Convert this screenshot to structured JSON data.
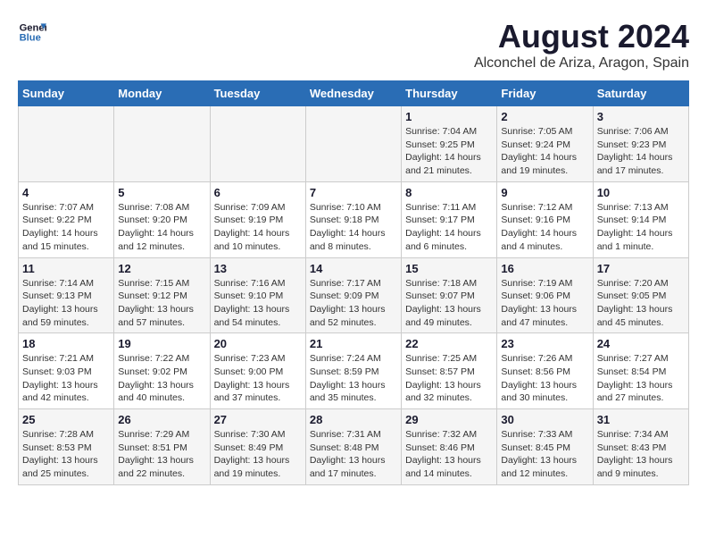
{
  "header": {
    "logo_line1": "General",
    "logo_line2": "Blue",
    "title": "August 2024",
    "subtitle": "Alconchel de Ariza, Aragon, Spain"
  },
  "weekdays": [
    "Sunday",
    "Monday",
    "Tuesday",
    "Wednesday",
    "Thursday",
    "Friday",
    "Saturday"
  ],
  "weeks": [
    [
      {
        "day": "",
        "info": ""
      },
      {
        "day": "",
        "info": ""
      },
      {
        "day": "",
        "info": ""
      },
      {
        "day": "",
        "info": ""
      },
      {
        "day": "1",
        "info": "Sunrise: 7:04 AM\nSunset: 9:25 PM\nDaylight: 14 hours\nand 21 minutes."
      },
      {
        "day": "2",
        "info": "Sunrise: 7:05 AM\nSunset: 9:24 PM\nDaylight: 14 hours\nand 19 minutes."
      },
      {
        "day": "3",
        "info": "Sunrise: 7:06 AM\nSunset: 9:23 PM\nDaylight: 14 hours\nand 17 minutes."
      }
    ],
    [
      {
        "day": "4",
        "info": "Sunrise: 7:07 AM\nSunset: 9:22 PM\nDaylight: 14 hours\nand 15 minutes."
      },
      {
        "day": "5",
        "info": "Sunrise: 7:08 AM\nSunset: 9:20 PM\nDaylight: 14 hours\nand 12 minutes."
      },
      {
        "day": "6",
        "info": "Sunrise: 7:09 AM\nSunset: 9:19 PM\nDaylight: 14 hours\nand 10 minutes."
      },
      {
        "day": "7",
        "info": "Sunrise: 7:10 AM\nSunset: 9:18 PM\nDaylight: 14 hours\nand 8 minutes."
      },
      {
        "day": "8",
        "info": "Sunrise: 7:11 AM\nSunset: 9:17 PM\nDaylight: 14 hours\nand 6 minutes."
      },
      {
        "day": "9",
        "info": "Sunrise: 7:12 AM\nSunset: 9:16 PM\nDaylight: 14 hours\nand 4 minutes."
      },
      {
        "day": "10",
        "info": "Sunrise: 7:13 AM\nSunset: 9:14 PM\nDaylight: 14 hours\nand 1 minute."
      }
    ],
    [
      {
        "day": "11",
        "info": "Sunrise: 7:14 AM\nSunset: 9:13 PM\nDaylight: 13 hours\nand 59 minutes."
      },
      {
        "day": "12",
        "info": "Sunrise: 7:15 AM\nSunset: 9:12 PM\nDaylight: 13 hours\nand 57 minutes."
      },
      {
        "day": "13",
        "info": "Sunrise: 7:16 AM\nSunset: 9:10 PM\nDaylight: 13 hours\nand 54 minutes."
      },
      {
        "day": "14",
        "info": "Sunrise: 7:17 AM\nSunset: 9:09 PM\nDaylight: 13 hours\nand 52 minutes."
      },
      {
        "day": "15",
        "info": "Sunrise: 7:18 AM\nSunset: 9:07 PM\nDaylight: 13 hours\nand 49 minutes."
      },
      {
        "day": "16",
        "info": "Sunrise: 7:19 AM\nSunset: 9:06 PM\nDaylight: 13 hours\nand 47 minutes."
      },
      {
        "day": "17",
        "info": "Sunrise: 7:20 AM\nSunset: 9:05 PM\nDaylight: 13 hours\nand 45 minutes."
      }
    ],
    [
      {
        "day": "18",
        "info": "Sunrise: 7:21 AM\nSunset: 9:03 PM\nDaylight: 13 hours\nand 42 minutes."
      },
      {
        "day": "19",
        "info": "Sunrise: 7:22 AM\nSunset: 9:02 PM\nDaylight: 13 hours\nand 40 minutes."
      },
      {
        "day": "20",
        "info": "Sunrise: 7:23 AM\nSunset: 9:00 PM\nDaylight: 13 hours\nand 37 minutes."
      },
      {
        "day": "21",
        "info": "Sunrise: 7:24 AM\nSunset: 8:59 PM\nDaylight: 13 hours\nand 35 minutes."
      },
      {
        "day": "22",
        "info": "Sunrise: 7:25 AM\nSunset: 8:57 PM\nDaylight: 13 hours\nand 32 minutes."
      },
      {
        "day": "23",
        "info": "Sunrise: 7:26 AM\nSunset: 8:56 PM\nDaylight: 13 hours\nand 30 minutes."
      },
      {
        "day": "24",
        "info": "Sunrise: 7:27 AM\nSunset: 8:54 PM\nDaylight: 13 hours\nand 27 minutes."
      }
    ],
    [
      {
        "day": "25",
        "info": "Sunrise: 7:28 AM\nSunset: 8:53 PM\nDaylight: 13 hours\nand 25 minutes."
      },
      {
        "day": "26",
        "info": "Sunrise: 7:29 AM\nSunset: 8:51 PM\nDaylight: 13 hours\nand 22 minutes."
      },
      {
        "day": "27",
        "info": "Sunrise: 7:30 AM\nSunset: 8:49 PM\nDaylight: 13 hours\nand 19 minutes."
      },
      {
        "day": "28",
        "info": "Sunrise: 7:31 AM\nSunset: 8:48 PM\nDaylight: 13 hours\nand 17 minutes."
      },
      {
        "day": "29",
        "info": "Sunrise: 7:32 AM\nSunset: 8:46 PM\nDaylight: 13 hours\nand 14 minutes."
      },
      {
        "day": "30",
        "info": "Sunrise: 7:33 AM\nSunset: 8:45 PM\nDaylight: 13 hours\nand 12 minutes."
      },
      {
        "day": "31",
        "info": "Sunrise: 7:34 AM\nSunset: 8:43 PM\nDaylight: 13 hours\nand 9 minutes."
      }
    ]
  ]
}
